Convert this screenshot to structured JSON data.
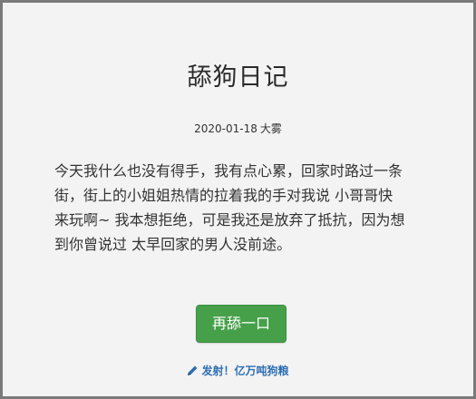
{
  "title": "舔狗日记",
  "meta": {
    "date": "2020-01-18",
    "weather": "大雾"
  },
  "content_lines": [
    "今天我什么也没有得手，我有点心累，回家时路过一条",
    "街，街上的小姐姐热情的拉着我的手对我说 小哥哥快",
    "来玩啊~ 我本想拒绝，可是我还是放弃了抵抗，因为想",
    "到你曾说过 太早回家的男人没前途。"
  ],
  "button_label": "再舔一口",
  "link": {
    "icon": "pencil-icon",
    "label": "发射！亿万吨狗粮"
  },
  "colors": {
    "button": "#46a04a",
    "link": "#2f6fb2"
  }
}
